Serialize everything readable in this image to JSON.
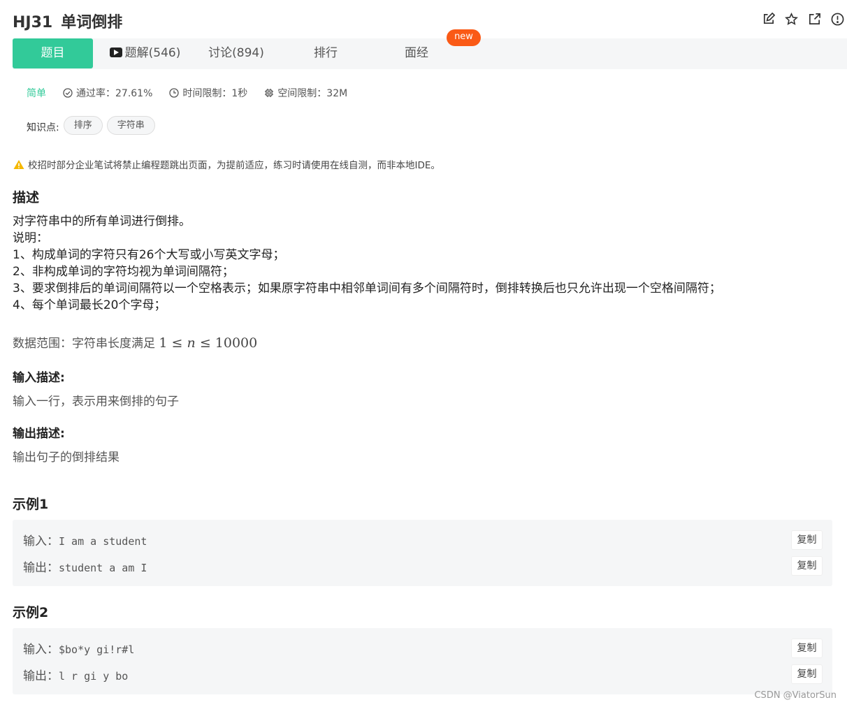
{
  "header": {
    "id": "HJ31",
    "name": "单词倒排"
  },
  "tabs": [
    {
      "label": "题目"
    },
    {
      "label": "题解(546)"
    },
    {
      "label": "讨论(894)"
    },
    {
      "label": "排行"
    },
    {
      "label": "面经"
    }
  ],
  "new_badge": "new",
  "meta": {
    "difficulty": "简单",
    "pass_rate": "通过率：27.61%",
    "time_limit": "时间限制：1秒",
    "space_limit": "空间限制：32M"
  },
  "knowledge": {
    "label": "知识点:",
    "tags": [
      "排序",
      "字符串"
    ]
  },
  "warning": "校招时部分企业笔试将禁止编程题跳出页面，为提前适应，练习时请使用在线自测，而非本地IDE。",
  "description": {
    "heading": "描述",
    "lines": [
      "对字符串中的所有单词进行倒排。",
      "说明：",
      "1、构成单词的字符只有26个大写或小写英文字母；",
      "2、非构成单词的字符均视为单词间隔符；",
      "3、要求倒排后的单词间隔符以一个空格表示；如果原字符串中相邻单词间有多个间隔符时，倒排转换后也只允许出现一个空格间隔符；",
      "4、每个单词最长20个字母；"
    ],
    "range_prefix": "数据范围：字符串长度满足 ",
    "range_low": "1",
    "range_le1": "≤",
    "range_var": "n",
    "range_le2": "≤",
    "range_high": "10000"
  },
  "input_desc": {
    "heading": "输入描述:",
    "text": "输入一行，表示用来倒排的句子"
  },
  "output_desc": {
    "heading": "输出描述:",
    "text": "输出句子的倒排结果"
  },
  "examples": [
    {
      "heading": "示例1",
      "input_label": "输入：",
      "input": "I am a student",
      "output_label": "输出：",
      "output": "student a am I",
      "copy_label": "复制"
    },
    {
      "heading": "示例2",
      "input_label": "输入：",
      "input": "$bo*y gi!r#l",
      "output_label": "输出：",
      "output": "l r gi y bo",
      "copy_label": "复制"
    }
  ],
  "watermark": "CSDN @ViatorSun",
  "colors": {
    "accent": "#32ca99",
    "badge": "#fa5a16",
    "warning": "#f5b800"
  }
}
